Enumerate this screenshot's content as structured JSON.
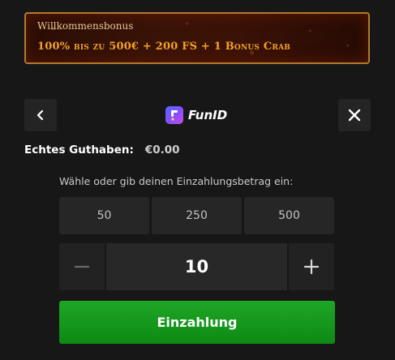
{
  "bonus": {
    "title": "Willkommensbonus",
    "offer": "100% bis zu 500€ + 200 FS + 1 Bonus Crab"
  },
  "header": {
    "brand_name": "FunID",
    "back_icon": "chevron-left-icon",
    "close_icon": "close-icon"
  },
  "balance": {
    "label": "Echtes Guthaben:",
    "value": "€0.00"
  },
  "amount": {
    "prompt": "Wähle oder gib deinen Einzahlungsbetrag ein:",
    "presets": [
      "50",
      "250",
      "500"
    ],
    "current_value": "10",
    "decrement_icon": "minus-icon",
    "increment_icon": "plus-icon"
  },
  "actions": {
    "deposit_label": "Einzahlung"
  },
  "colors": {
    "background": "#171717",
    "bonus_border": "#b07a2e",
    "bonus_offer_text": "#f3a127",
    "deposit_green": "#13961b"
  }
}
